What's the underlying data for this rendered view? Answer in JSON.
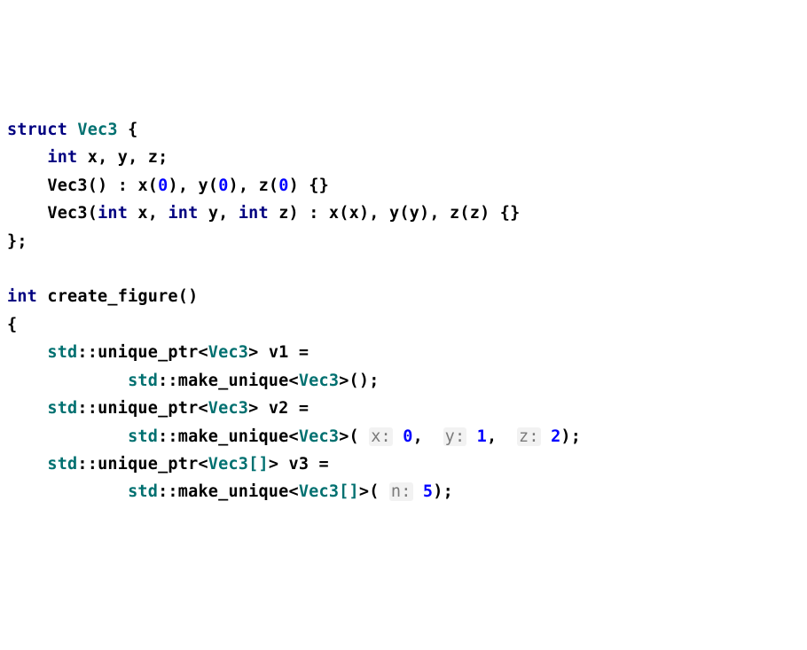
{
  "kw_struct": "struct",
  "kw_int": "int",
  "type_Vec3": "Vec3",
  "type_Vec3Arr": "Vec3[]",
  "type_std": "std",
  "id_unique_ptr": "unique_ptr",
  "id_make_unique": "make_unique",
  "id_x": "x",
  "id_y": "y",
  "id_z": "z",
  "id_v1": "v1",
  "id_v2": "v2",
  "id_v3": "v3",
  "id_create_figure": "create_figure",
  "num_0": "0",
  "num_1": "1",
  "num_2": "2",
  "num_5": "5",
  "pun_open_brace": "{",
  "pun_close_brace": "}",
  "pun_close_brace_semi": "};",
  "pun_open_paren": "(",
  "pun_close_paren": ")",
  "pun_close_paren_semi": ");",
  "pun_empty_parens": "()",
  "pun_empty_braces": "{}",
  "pun_semi": ";",
  "pun_comma": ",",
  "pun_colon": ":",
  "pun_dblcolon": "::",
  "pun_lt": "<",
  "pun_gt": ">",
  "pun_eq": "=",
  "hint_x": "x:",
  "hint_y": "y:",
  "hint_z": "z:",
  "hint_n": "n:"
}
